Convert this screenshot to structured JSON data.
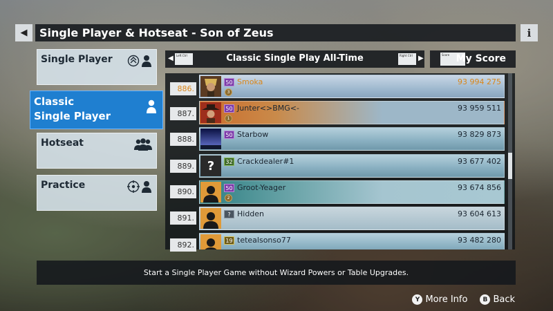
{
  "header": {
    "back_icon": "◀",
    "title": "Single Player & Hotseat - Son of Zeus",
    "info_icon": "i"
  },
  "menu": [
    {
      "label": "Single Player",
      "icons": [
        "mode-icon",
        "person-icon"
      ],
      "active": false
    },
    {
      "label_line1": "Classic",
      "label_line2": "Single Player",
      "icons": [
        "person-icon"
      ],
      "active": true
    },
    {
      "label": "Hotseat",
      "icons": [
        "group-icon"
      ],
      "active": false
    },
    {
      "label": "Practice",
      "icons": [
        "target-icon",
        "person-icon"
      ],
      "active": false
    }
  ],
  "board": {
    "title": "Classic Single Play All-Time",
    "left_chip": "Left Ctrl",
    "right_chip": "Right Ctrl",
    "score_chip": "Score",
    "score_label": "My Score"
  },
  "rows": [
    {
      "rank": "886.",
      "level": "50",
      "name": "Smoka",
      "score": "93 994 275",
      "highlight": true,
      "avatar": "pharaoh",
      "medal": "3"
    },
    {
      "rank": "887.",
      "level": "50",
      "name": "Junter<>BMG<-",
      "score": "93 959 511",
      "highlight": false,
      "avatar": "cowboy",
      "medal": "1"
    },
    {
      "rank": "888.",
      "level": "50",
      "name": "Starbow",
      "score": "93 829 873",
      "highlight": false,
      "avatar": "sky",
      "medal": ""
    },
    {
      "rank": "889.",
      "level": "32",
      "name": "Crackdealer#1",
      "score": "93 677 402",
      "highlight": false,
      "avatar": "unknown",
      "medal": ""
    },
    {
      "rank": "890.",
      "level": "50",
      "name": "Groot-Yeager",
      "score": "93 674 856",
      "highlight": false,
      "avatar": "silhouette",
      "medal": "2"
    },
    {
      "rank": "891.",
      "level": "?",
      "name": "Hidden",
      "score": "93 604 613",
      "highlight": false,
      "avatar": "silhouette",
      "medal": ""
    },
    {
      "rank": "892.",
      "level": "19",
      "name": "tetealsonso77",
      "score": "93 482 280",
      "highlight": false,
      "avatar": "silhouette",
      "medal": ""
    }
  ],
  "description": "Start a Single Player Game without Wizard Powers or Table Upgrades.",
  "footer": {
    "more_info_key": "Y",
    "more_info_label": "More Info",
    "back_key": "B",
    "back_label": "Back"
  },
  "colors": {
    "accent": "#1f7fd0",
    "highlight_text": "#d9861a"
  }
}
